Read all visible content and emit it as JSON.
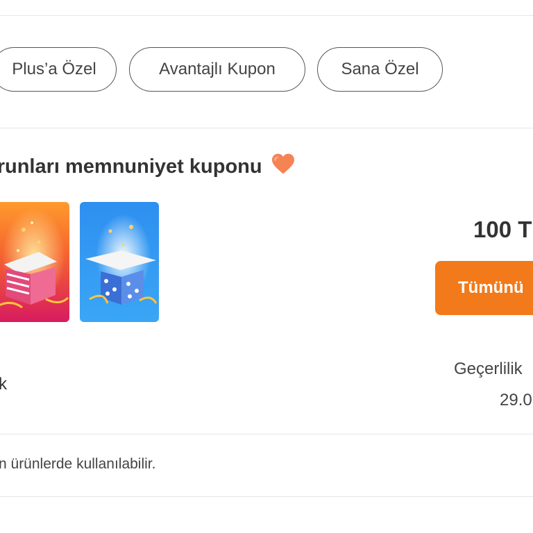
{
  "filters": {
    "chips": [
      "Plus’a Özel",
      "Avantajlı Kupon",
      "Sana Özel"
    ]
  },
  "coupon": {
    "title": "orunları memnuniyet kuponu",
    "heart_icon": "heart-icon",
    "amount": "100 T",
    "cta_label": "Tümünü",
    "left_fragment": "k",
    "validity_label": "Geçerlilik",
    "validity_date": "29.0",
    "note": "n ürünlerde kullanılabilir."
  },
  "colors": {
    "accent": "#f27a1a",
    "heart": "#f58455"
  }
}
